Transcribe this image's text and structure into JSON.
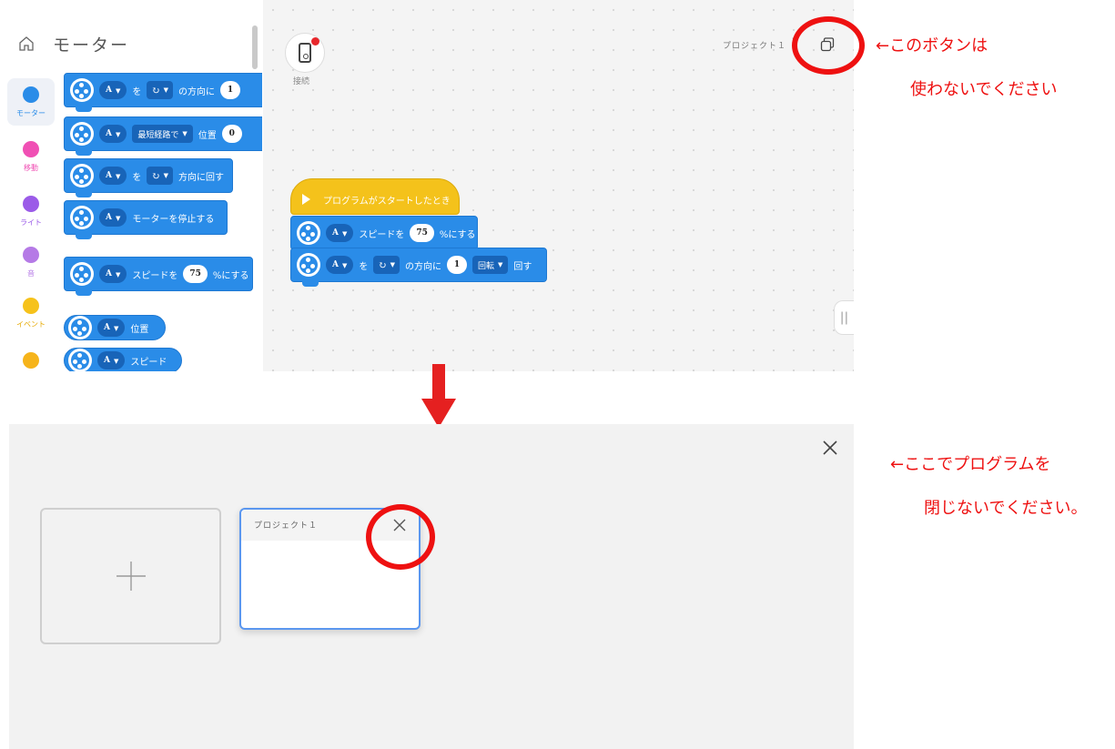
{
  "top": {
    "category_title": "モーター",
    "categories": [
      {
        "label": "モーター",
        "color": "#2a8ce8"
      },
      {
        "label": "移動",
        "color": "#f050b4"
      },
      {
        "label": "ライト",
        "color": "#9b5be8"
      },
      {
        "label": "音",
        "color": "#b57ae6"
      },
      {
        "label": "イベント",
        "color": "#f6c21b"
      },
      {
        "label": "",
        "color": "#f6b41b"
      }
    ],
    "palette_blocks": {
      "b1": {
        "port": "A",
        "particle": "を",
        "dir": "↻",
        "text": "の方向に",
        "value": "1"
      },
      "b2": {
        "port": "A",
        "mode": "最短経路で",
        "text": "位置",
        "value": "0"
      },
      "b3": {
        "port": "A",
        "particle": "を",
        "dir": "↻",
        "text": "方向に回す"
      },
      "b4": {
        "port": "A",
        "text": "モーターを停止する"
      },
      "b5": {
        "port": "A",
        "pre": "スピードを",
        "value": "75",
        "post": "%にする"
      },
      "b6": {
        "port": "A",
        "text": "位置"
      },
      "b7": {
        "port": "A",
        "text": "スピード"
      }
    },
    "connect_label": "接続",
    "project_name": "プロジェクト１",
    "script": {
      "hat": "プログラムがスタートしたとき",
      "s1": {
        "port": "A",
        "pre": "スピードを",
        "value": "75",
        "post": "%にする"
      },
      "s2": {
        "port": "A",
        "particle": "を",
        "dir": "↻",
        "text": "の方向に",
        "value": "1",
        "unit": "回転",
        "post": "回す"
      }
    }
  },
  "annotations": {
    "top_line1": "←このボタンは",
    "top_line2": "使わないでください",
    "bottom_line1": "←ここでプログラムを",
    "bottom_line2": "閉じないでください。",
    "color": "#ee1111"
  },
  "bottom": {
    "new_project_symbol": "+",
    "project_card_title": "プロジェクト１"
  }
}
